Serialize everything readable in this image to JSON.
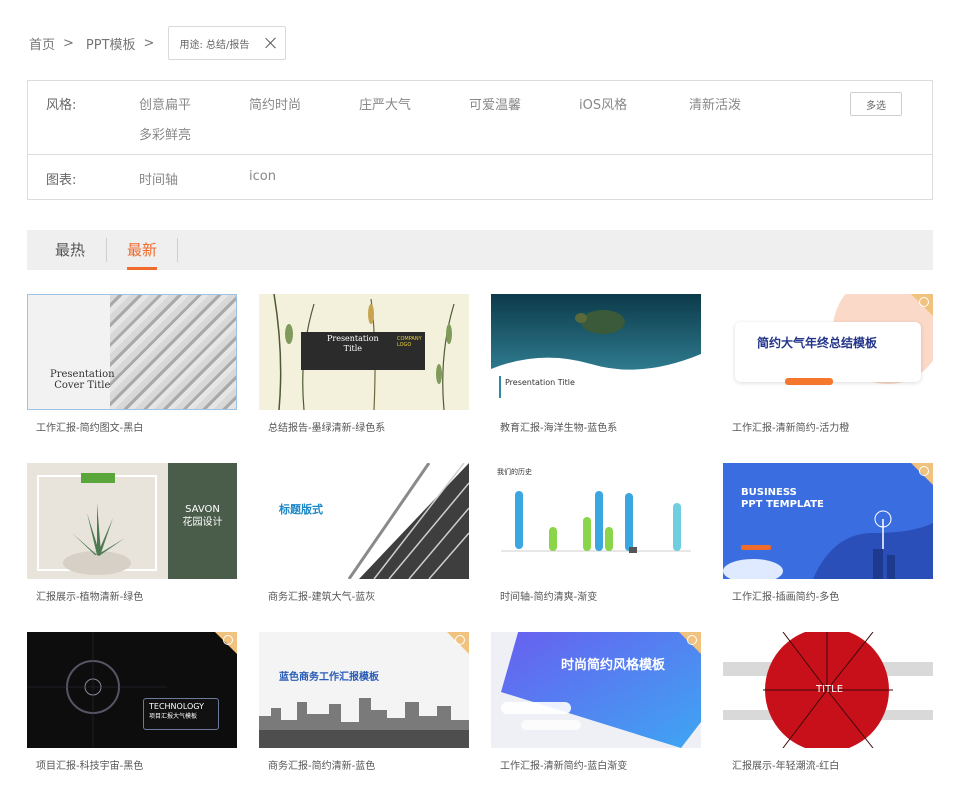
{
  "breadcrumb": {
    "home": "首页",
    "section": "PPT模板",
    "sep": ">",
    "tag": "用途: 总结/报告"
  },
  "filters": {
    "style_label": "风格:",
    "style_options": [
      "创意扁平",
      "简约时尚",
      "庄严大气",
      "可爱温馨",
      "iOS风格",
      "清新活泼",
      "多彩鲜亮"
    ],
    "multi_label": "多选",
    "chart_label": "图表:",
    "chart_options": [
      "时间轴",
      "icon"
    ]
  },
  "tabs": {
    "hot": "最热",
    "new": "最新"
  },
  "colors": {
    "accent": "#f06b2c",
    "vip": "#f1c27d"
  },
  "cards": [
    {
      "caption": "工作汇报-简约图文-黑白",
      "thumb_lines": [
        "Presentation",
        "Cover Title"
      ]
    },
    {
      "caption": "总结报告-墨绿清新-绿色系",
      "thumb_lines": [
        "Presentation",
        "Title",
        "COMPANY LOGO"
      ]
    },
    {
      "caption": "教育汇报-海洋生物-蓝色系",
      "thumb_lines": [
        "Presentation Title"
      ]
    },
    {
      "caption": "工作汇报-清新简约-活力橙",
      "thumb_lines": [
        "简约大气年终总结模板"
      ]
    },
    {
      "caption": "汇报展示-植物清新-绿色",
      "thumb_lines": [
        "SAVON",
        "花园设计"
      ]
    },
    {
      "caption": "商务汇报-建筑大气-蓝灰",
      "thumb_lines": [
        "标题版式"
      ]
    },
    {
      "caption": "时间轴-简约清爽-渐变",
      "thumb_lines": [
        "我们的历史"
      ]
    },
    {
      "caption": "工作汇报-插画简约-多色",
      "thumb_lines": [
        "BUSINESS",
        "PPT TEMPLATE"
      ]
    },
    {
      "caption": "项目汇报-科技宇宙-黑色",
      "thumb_lines": [
        "TECHNOLOGY",
        "项目汇报大气模板"
      ]
    },
    {
      "caption": "商务汇报-简约清新-蓝色",
      "thumb_lines": [
        "蓝色商务工作汇报模板"
      ]
    },
    {
      "caption": "工作汇报-清新简约-蓝白渐变",
      "thumb_lines": [
        "时尚简约风格模板"
      ]
    },
    {
      "caption": "汇报展示-年轻潮流-红白",
      "thumb_lines": [
        "TITLE"
      ]
    }
  ]
}
